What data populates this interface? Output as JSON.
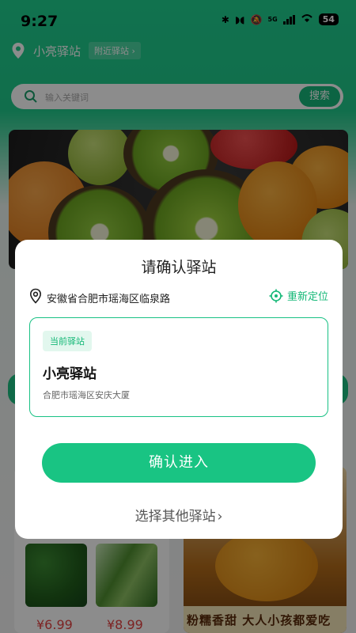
{
  "status_bar": {
    "time": "9:27",
    "network": "5G",
    "battery": "54"
  },
  "header": {
    "location_name": "小亮驿站",
    "nearby_label": "附近驿站",
    "nearby_chevron": "›"
  },
  "search": {
    "placeholder": "输入关键词",
    "button_label": "搜索"
  },
  "products": {
    "left_card": {
      "prices": [
        "¥6.99",
        "¥8.99"
      ]
    },
    "right_card": {
      "tagline": "粉糯香甜 大人小孩都爱吃"
    }
  },
  "modal": {
    "title": "请确认驿站",
    "current_address": "安徽省合肥市瑶海区临泉路",
    "relocate_label": "重新定位",
    "station_card": {
      "tag": "当前驿站",
      "name": "小亮驿站",
      "address": "合肥市瑶海区安庆大厦"
    },
    "confirm_label": "确认进入",
    "other_label": "选择其他驿站",
    "other_chevron": "›"
  },
  "colors": {
    "brand_green": "#19c483",
    "price_red": "#e34040",
    "overlay": "rgba(0,0,0,0.45)"
  },
  "icons": {
    "location": "location-pin-icon",
    "search": "search-icon",
    "relocate": "crosshair-icon",
    "chevron": "chevron-right-icon"
  }
}
